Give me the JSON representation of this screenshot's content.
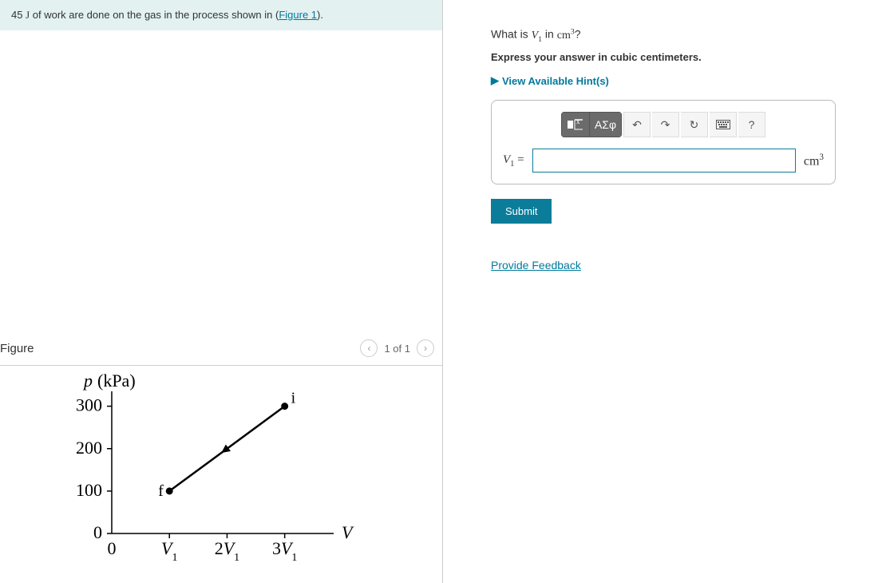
{
  "problem": {
    "prefix": "45 ",
    "work_unit": "J",
    "mid_text": " of work are done on the gas in the process shown in (",
    "figure_link_text": "Figure 1",
    "suffix": ")."
  },
  "figure_panel": {
    "title": "Figure",
    "nav_prev_glyph": "‹",
    "nav_text": "1 of 1",
    "nav_next_glyph": "›"
  },
  "chart_data": {
    "type": "line",
    "title": "",
    "xlabel": "V",
    "ylabel": "p (kPa)",
    "y_ticks": [
      0,
      100,
      200,
      300
    ],
    "x_ticks_labels": [
      "0",
      "V₁",
      "2V₁",
      "3V₁"
    ],
    "ylim": [
      0,
      320
    ],
    "xlim": [
      0,
      3.6
    ],
    "series": [
      {
        "name": "process",
        "points": [
          {
            "x": 1,
            "y": 100,
            "label": "f"
          },
          {
            "x": 3,
            "y": 300,
            "label": "i"
          }
        ],
        "arrow_from_index": 1,
        "arrow_to_index": 0
      }
    ]
  },
  "question": {
    "prompt_pre": "What is ",
    "prompt_var_html": "V₁",
    "prompt_mid": " in ",
    "prompt_unit": "cm³",
    "prompt_post": "?",
    "instruction": "Express your answer in cubic centimeters.",
    "hint_label": "View Available Hint(s)",
    "lhs_label": "V₁ =",
    "unit_label": "cm³",
    "input_value": ""
  },
  "toolbar": {
    "templates_icon_text": "",
    "greek_label": "ΑΣφ",
    "undo_glyph": "↶",
    "redo_glyph": "↷",
    "reset_glyph": "↻",
    "keyboard_glyph": "⌨",
    "help_glyph": "?"
  },
  "actions": {
    "submit_label": "Submit",
    "feedback_label": "Provide Feedback"
  }
}
